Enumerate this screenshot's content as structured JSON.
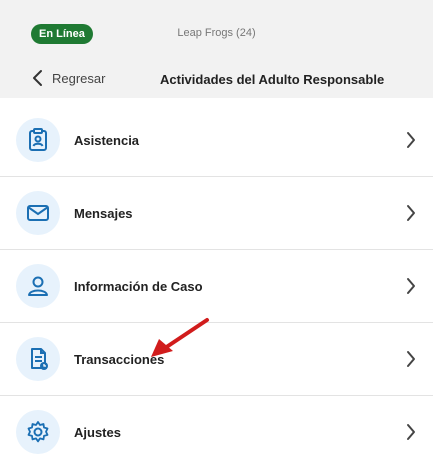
{
  "status": {
    "badge": "En Línea",
    "center_title": "Leap Frogs (24)"
  },
  "navigation": {
    "back_label": "Regresar",
    "page_title": "Actividades del Adulto Responsable"
  },
  "menu": {
    "items": [
      {
        "label": "Asistencia",
        "icon": "clipboard-id-icon"
      },
      {
        "label": "Mensajes",
        "icon": "envelope-icon"
      },
      {
        "label": "Información de Caso",
        "icon": "user-profile-icon"
      },
      {
        "label": "Transacciones",
        "icon": "document-clock-icon"
      },
      {
        "label": "Ajustes",
        "icon": "gear-icon"
      }
    ]
  },
  "colors": {
    "badge_bg": "#1f7a33",
    "icon_blue": "#1b6fb3",
    "icon_bg": "#e7f2fc",
    "arrow_red": "#d11c1c"
  }
}
